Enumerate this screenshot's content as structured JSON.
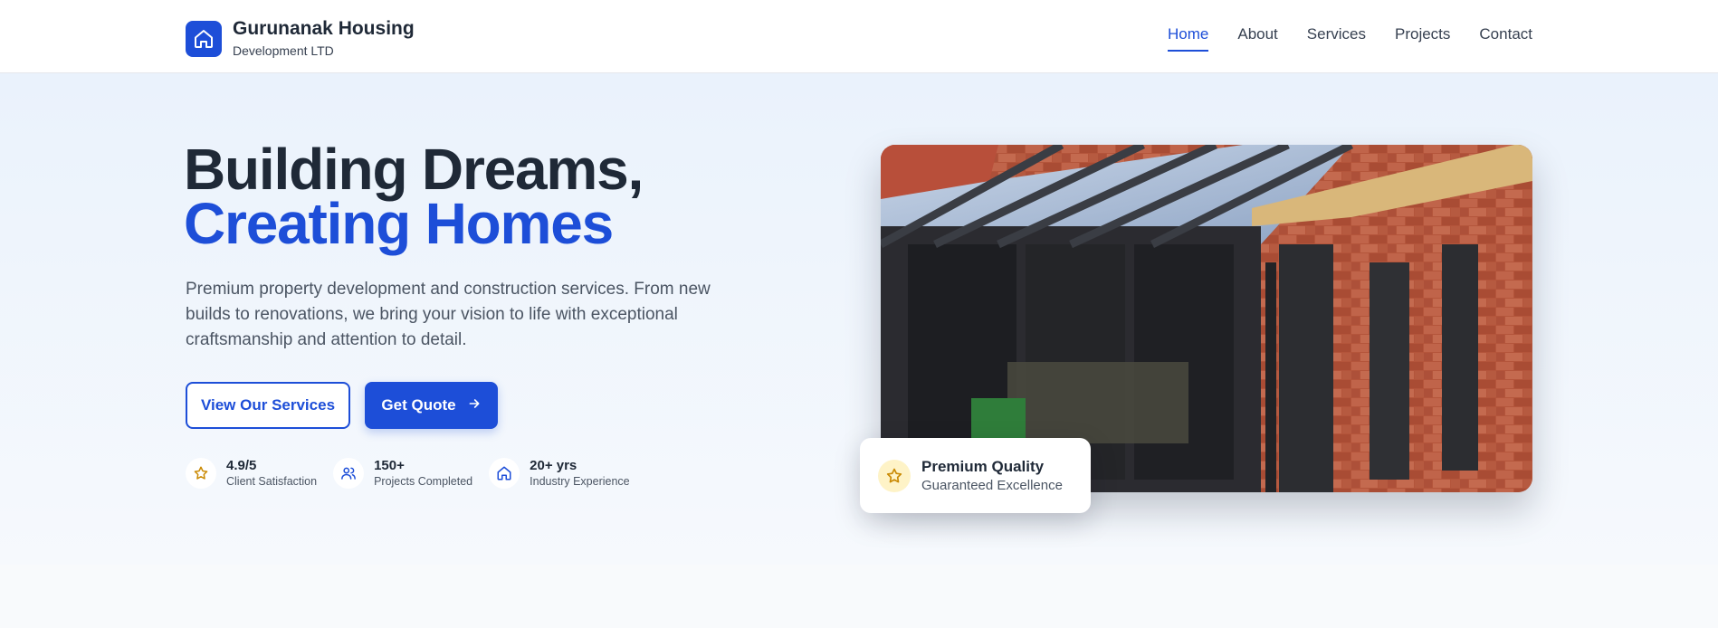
{
  "brand": {
    "name": "Gurunanak Housing",
    "subtitle": "Development LTD",
    "logo_icon": "house-icon"
  },
  "nav": {
    "items": [
      {
        "label": "Home",
        "active": true
      },
      {
        "label": "About",
        "active": false
      },
      {
        "label": "Services",
        "active": false
      },
      {
        "label": "Projects",
        "active": false
      },
      {
        "label": "Contact",
        "active": false
      }
    ]
  },
  "hero": {
    "headline_line1": "Building Dreams,",
    "headline_line2": "Creating Homes",
    "description": "Premium property development and construction services. From new builds to renovations, we bring your vision to life with exceptional craftsmanship and attention to detail.",
    "secondary_button": "View Our Services",
    "primary_button": "Get Quote",
    "primary_button_icon": "arrow-right-icon"
  },
  "stats": [
    {
      "value": "4.9/5",
      "label": "Client Satisfaction",
      "icon": "star-icon"
    },
    {
      "value": "150+",
      "label": "Projects Completed",
      "icon": "users-icon"
    },
    {
      "value": "20+ yrs",
      "label": "Industry Experience",
      "icon": "house-icon"
    }
  ],
  "quality_card": {
    "title": "Premium Quality",
    "subtitle": "Guaranteed Excellence",
    "icon": "star-icon"
  },
  "colors": {
    "accent": "#1d4ed8",
    "heading": "#1f2937",
    "body_text": "#4b5563",
    "star": "#ca8a04",
    "star_bg": "#fef3c7"
  }
}
